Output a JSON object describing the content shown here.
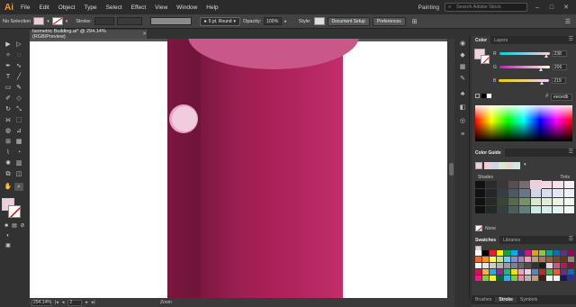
{
  "app": {
    "logo": "Ai",
    "workspace": "Painting",
    "search_placeholder": "Search Adobe Stock"
  },
  "menu": [
    "File",
    "Edit",
    "Object",
    "Type",
    "Select",
    "Effect",
    "View",
    "Window",
    "Help"
  ],
  "control_bar": {
    "selection": "No Selection",
    "stroke_label": "Stroke:",
    "brush": "5 pt. Round",
    "opacity_label": "Opacity:",
    "opacity_value": "100%",
    "style_label": "Style:",
    "doc_setup": "Document Setup",
    "preferences": "Preferences"
  },
  "document": {
    "tab_title": "Isometric Building.ai* @ 294.14% (RGB/Preview)"
  },
  "status": {
    "zoom": "294.14%",
    "page": "2",
    "tool": "Zoom"
  },
  "color_panel": {
    "tabs": [
      "Color",
      "Layers"
    ],
    "r_label": "R",
    "r_value": "238",
    "g_label": "G",
    "g_value": "206",
    "b_label": "B",
    "b_value": "219",
    "hex": "eecedb",
    "fill_color": "#eecedb"
  },
  "color_guide": {
    "title": "Color Guide",
    "shades_label": "Shades",
    "tints_label": "Tints",
    "none_label": "None"
  },
  "swatches": {
    "tabs": [
      "Swatches",
      "Libraries"
    ]
  },
  "bottom_tabs": [
    "Brushes",
    "Stroke",
    "Symbols"
  ],
  "icons": {
    "menu_logo": "ai-logo",
    "search": "search-icon",
    "window_minimize": "minimize-icon",
    "window_maximize": "maximize-icon",
    "window_close": "close-icon"
  }
}
